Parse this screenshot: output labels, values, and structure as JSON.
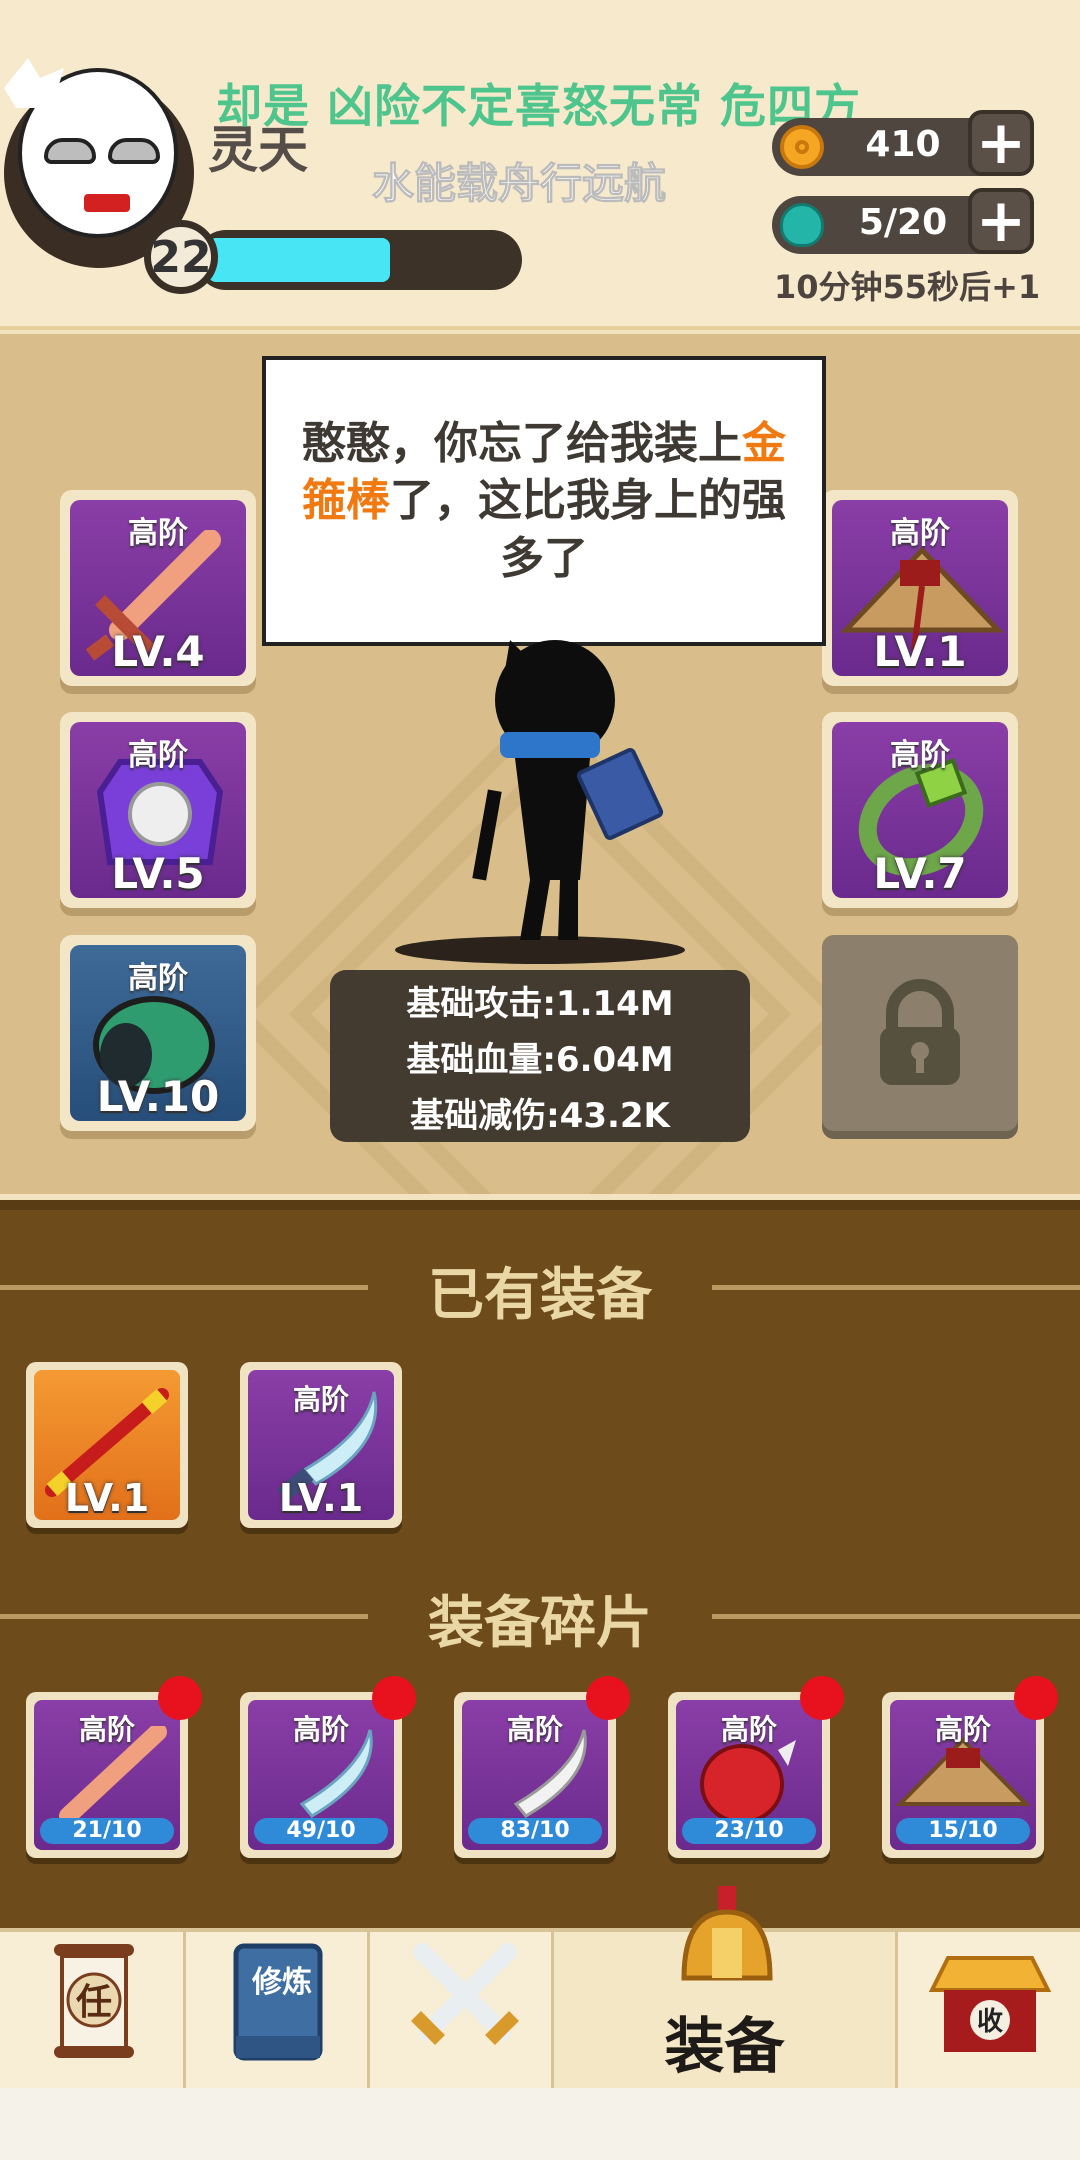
{
  "player": {
    "name": "灵天",
    "level": "22",
    "xp_fraction": 0.6
  },
  "marquee": {
    "line1": "却是 凶险不定喜怒无常 危四方",
    "line2": "水能载舟行远航"
  },
  "resources": {
    "coins": {
      "icon": "coin-icon",
      "value": "410"
    },
    "stamina": {
      "icon": "balloon-icon",
      "value": "5/20"
    },
    "timer": "10分钟55秒后+1"
  },
  "speech": {
    "part1": "憨憨，你忘了给我装上",
    "highlight": "金箍棒",
    "part2": "了，这比我身上的强多了"
  },
  "equipped": {
    "left": [
      {
        "grade": "高阶",
        "level": "LV.4",
        "icon": "sword-icon"
      },
      {
        "grade": "高阶",
        "level": "LV.5",
        "icon": "armor-icon"
      },
      {
        "grade": "高阶",
        "level": "LV.10",
        "icon": "boots-icon"
      }
    ],
    "right": [
      {
        "grade": "高阶",
        "level": "LV.1",
        "icon": "straw-hat-icon"
      },
      {
        "grade": "高阶",
        "level": "LV.7",
        "icon": "bracelet-icon"
      }
    ]
  },
  "stats": {
    "attack": "基础攻击:1.14M",
    "hp": "基础血量:6.04M",
    "reduction": "基础减伤:43.2K"
  },
  "owned": {
    "title": "已有装备",
    "items": [
      {
        "grade": "",
        "level": "LV.1",
        "icon": "golden-staff-icon"
      },
      {
        "grade": "高阶",
        "level": "LV.1",
        "icon": "saber-icon"
      }
    ]
  },
  "fragments": {
    "title": "装备碎片",
    "items": [
      {
        "grade": "高阶",
        "progress": "21/10",
        "icon": "sword-icon"
      },
      {
        "grade": "高阶",
        "progress": "49/10",
        "icon": "saber-icon"
      },
      {
        "grade": "高阶",
        "progress": "83/10",
        "icon": "saber-icon"
      },
      {
        "grade": "高阶",
        "progress": "23/10",
        "icon": "gauntlet-icon"
      },
      {
        "grade": "高阶",
        "progress": "15/10",
        "icon": "straw-hat-icon"
      }
    ]
  },
  "nav": {
    "tasks": {
      "glyph": "任",
      "icon": "scroll-icon"
    },
    "train": {
      "glyph": "修炼",
      "icon": "book-icon"
    },
    "battle": {
      "icon": "crossed-swords-icon"
    },
    "equip": {
      "label": "装备",
      "icon": "helmet-icon"
    },
    "collect": {
      "glyph": "收",
      "icon": "shop-icon"
    }
  },
  "colors": {
    "accent_green": "#4ec58c",
    "highlight_orange": "#f07a11",
    "xp_cyan": "#48e6f4",
    "notify_red": "#e8121f",
    "inventory_brown": "#6d4b1b"
  }
}
